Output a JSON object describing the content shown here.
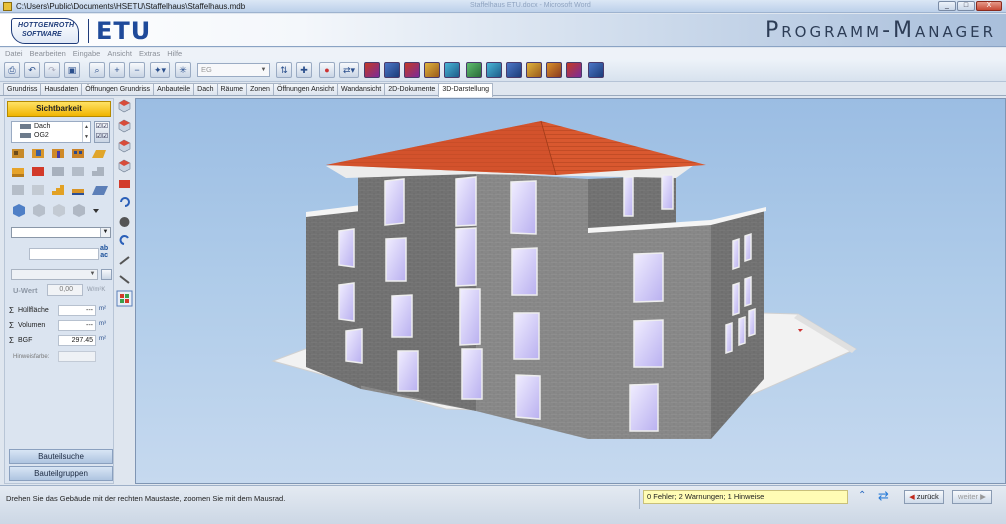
{
  "window": {
    "title": "C:\\Users\\Public\\Documents\\HSETU\\Staffelhaus\\Staffelhaus.mdb",
    "ghost_title": "Staffelhaus ETU.docx - Microsoft Word",
    "buttons": [
      "_",
      "□",
      "X"
    ]
  },
  "header": {
    "logo_line1": "HOTTGENROTH",
    "logo_line2": "SOFTWARE",
    "product": "ETU",
    "title": "Programm-Manager"
  },
  "menu": [
    "Datei",
    "Bearbeiten",
    "Eingabe",
    "Ansicht",
    "Extras",
    "Hilfe"
  ],
  "toolbar": {
    "floor_value": "EG"
  },
  "tabs": [
    {
      "label": "Grundriss",
      "active": false
    },
    {
      "label": "Hausdaten",
      "active": false
    },
    {
      "label": "Öffnungen Grundriss",
      "active": false
    },
    {
      "label": "Anbauteile",
      "active": false
    },
    {
      "label": "Dach",
      "active": false
    },
    {
      "label": "Räume",
      "active": false
    },
    {
      "label": "Zonen",
      "active": false
    },
    {
      "label": "Öffnungen Ansicht",
      "active": false
    },
    {
      "label": "Wandansicht",
      "active": false
    },
    {
      "label": "2D-Dokumente",
      "active": false
    },
    {
      "label": "3D-Darstellung",
      "active": true
    }
  ],
  "left_panel": {
    "visibility_label": "Sichtbarkeit",
    "floors": [
      "Dach",
      "OG2"
    ],
    "abc_line1": "ab",
    "abc_line2": "ac",
    "u_wert_label": "U-Wert",
    "u_wert_value": "0,00",
    "u_wert_unit": "W/m²K",
    "sums": [
      {
        "label": "Hüllfläche",
        "value": "---",
        "unit": "m²"
      },
      {
        "label": "Volumen",
        "value": "---",
        "unit": "m³"
      },
      {
        "label": "BGF",
        "value": "297.45",
        "unit": "m²"
      }
    ],
    "hinweis_label": "Hinweisfarbe:",
    "search_button": "Bauteilsuche",
    "groups_button": "Bauteilgruppen"
  },
  "status": {
    "hint": "Drehen Sie das Gebäude mit der rechten Maustaste, zoomen Sie mit dem Mausrad.",
    "errors": "0 Fehler; 2 Warnungen; 1 Hinweise",
    "back": "zurück",
    "next": "weiter"
  },
  "colors": {
    "accent": "#f0b400",
    "roof": "#d7532e",
    "wall": "#8c8c8c",
    "window": "#d9d2ff",
    "viewport_bg": "#a9c7e8"
  }
}
